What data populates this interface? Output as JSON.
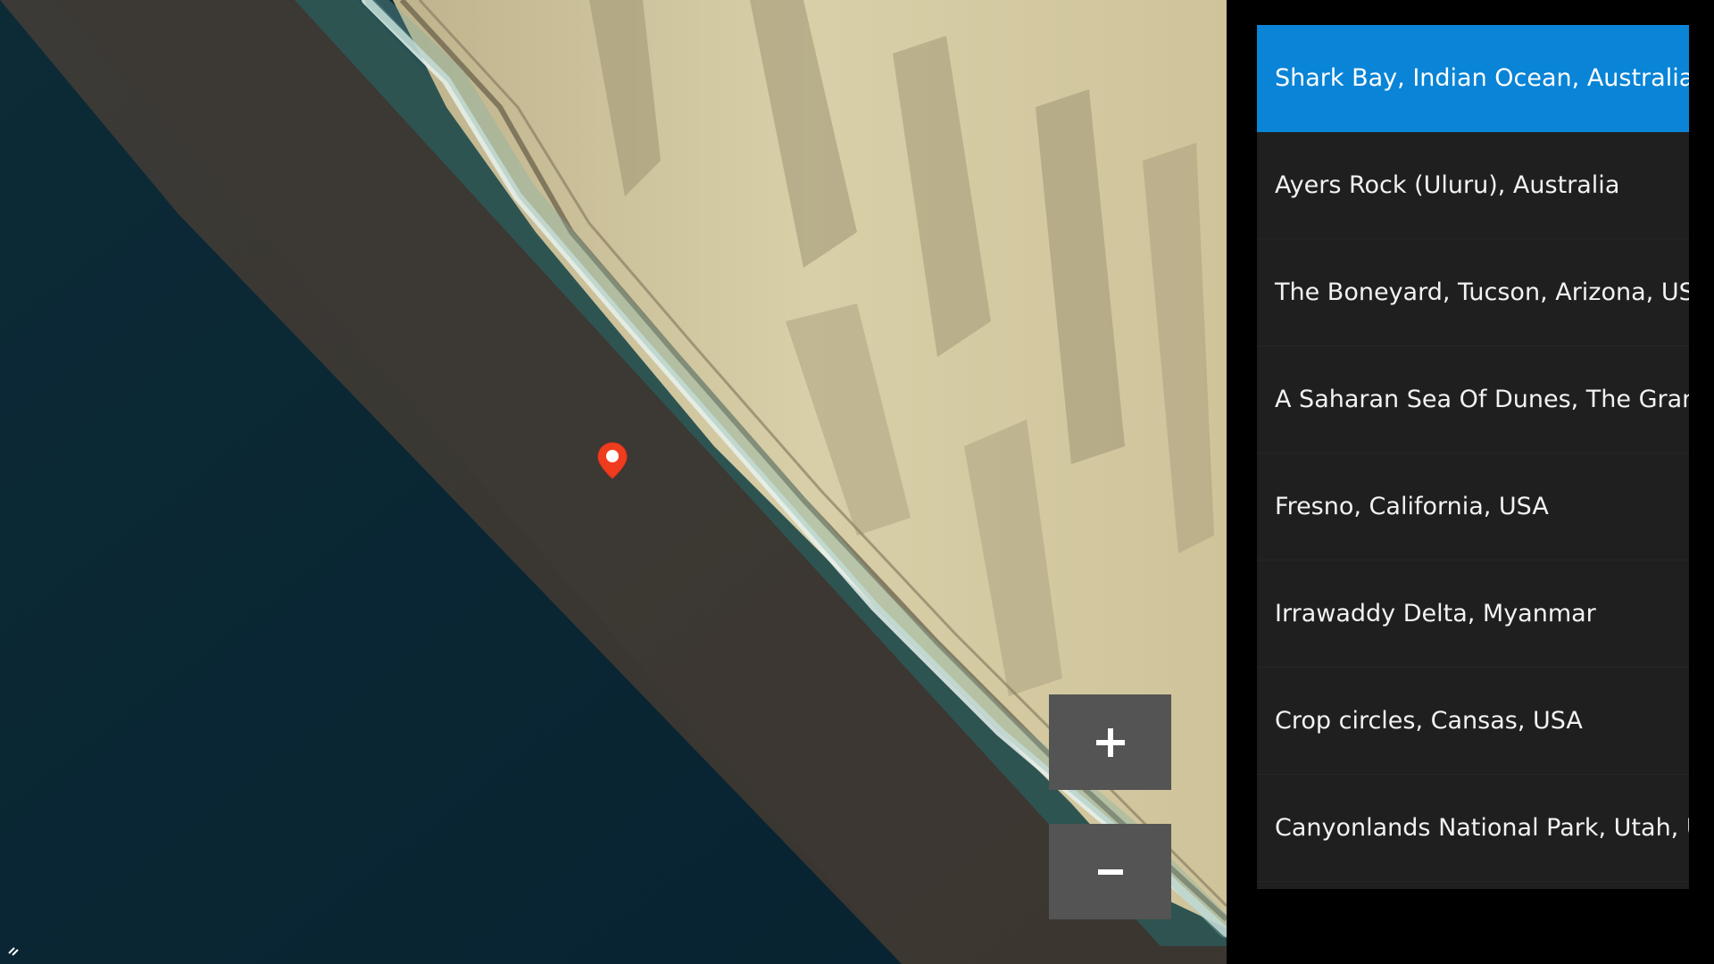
{
  "map": {
    "zoom_in_label": "+",
    "zoom_out_label": "−",
    "marker_icon": "map-pin-icon",
    "marker_color": "#f03c1e"
  },
  "locations": {
    "selected_color": "#0a84d6",
    "items": [
      {
        "label": "Shark Bay, Indian Ocean, Australia",
        "selected": true
      },
      {
        "label": "Ayers Rock (Uluru), Australia",
        "selected": false
      },
      {
        "label": "The Boneyard, Tucson, Arizona, USA",
        "selected": false
      },
      {
        "label": "A Saharan Sea Of Dunes, The Grand",
        "selected": false
      },
      {
        "label": "Fresno, California, USA",
        "selected": false
      },
      {
        "label": "Irrawaddy Delta, Myanmar",
        "selected": false
      },
      {
        "label": "Crop circles, Cansas, USA",
        "selected": false
      },
      {
        "label": "Canyonlands National Park, Utah, U",
        "selected": false
      }
    ]
  }
}
